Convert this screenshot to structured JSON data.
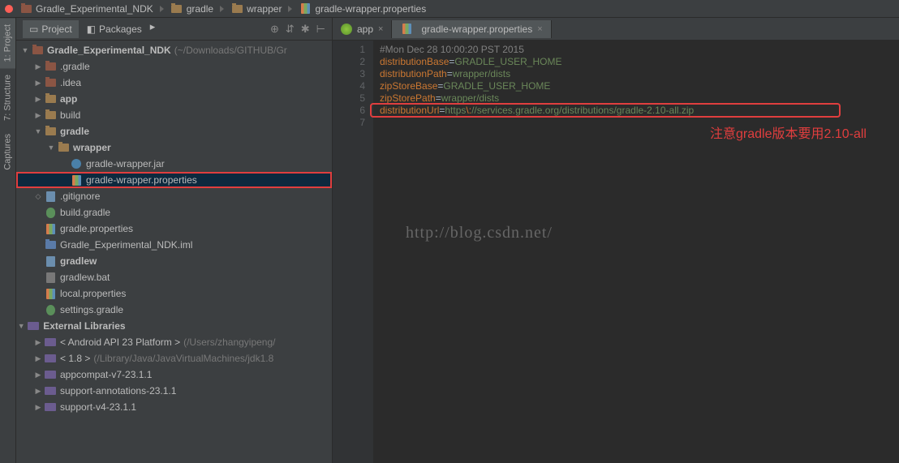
{
  "breadcrumb": [
    {
      "label": "Gradle_Experimental_NDK",
      "icon": "folder-red"
    },
    {
      "label": "gradle",
      "icon": "folder"
    },
    {
      "label": "wrapper",
      "icon": "folder"
    },
    {
      "label": "gradle-wrapper.properties",
      "icon": "props"
    }
  ],
  "leftbar": {
    "items": [
      "1: Project",
      "7: Structure",
      "Captures"
    ]
  },
  "panel": {
    "tabs": [
      "Project",
      "Packages"
    ],
    "active_tab": 0
  },
  "tree": {
    "root": {
      "label": "Gradle_Experimental_NDK",
      "sub": "(~/Downloads/GITHUB/Gr",
      "icon": "folder-red",
      "expanded": true
    },
    "items": [
      {
        "indent": 1,
        "label": ".gradle",
        "icon": "folder-red",
        "arrow": "right"
      },
      {
        "indent": 1,
        "label": ".idea",
        "icon": "folder-red",
        "arrow": "right"
      },
      {
        "indent": 1,
        "label": "app",
        "icon": "folder",
        "arrow": "right",
        "bold": true
      },
      {
        "indent": 1,
        "label": "build",
        "icon": "folder",
        "arrow": "right"
      },
      {
        "indent": 1,
        "label": "gradle",
        "icon": "folder",
        "arrow": "down",
        "bold": true
      },
      {
        "indent": 2,
        "label": "wrapper",
        "icon": "folder",
        "arrow": "down",
        "bold": true
      },
      {
        "indent": 3,
        "label": "gradle-wrapper.jar",
        "icon": "music"
      },
      {
        "indent": 3,
        "label": "gradle-wrapper.properties",
        "icon": "props",
        "selected": true
      },
      {
        "indent": 1,
        "label": ".gitignore",
        "icon": "file-txt",
        "arrow": "diamond"
      },
      {
        "indent": 1,
        "label": "build.gradle",
        "icon": "gradle"
      },
      {
        "indent": 1,
        "label": "gradle.properties",
        "icon": "props"
      },
      {
        "indent": 1,
        "label": "Gradle_Experimental_NDK.iml",
        "icon": "folder-blue"
      },
      {
        "indent": 1,
        "label": "gradlew",
        "icon": "file-txt",
        "bold": true
      },
      {
        "indent": 1,
        "label": "gradlew.bat",
        "icon": "file"
      },
      {
        "indent": 1,
        "label": "local.properties",
        "icon": "props"
      },
      {
        "indent": 1,
        "label": "settings.gradle",
        "icon": "gear"
      }
    ],
    "libs": {
      "label": "External Libraries",
      "expanded": true,
      "items": [
        {
          "label": "< Android API 23 Platform >",
          "sub": "(/Users/zhangyipeng/"
        },
        {
          "label": "< 1.8 >",
          "sub": "(/Library/Java/JavaVirtualMachines/jdk1.8"
        },
        {
          "label": "appcompat-v7-23.1.1",
          "sub": ""
        },
        {
          "label": "support-annotations-23.1.1",
          "sub": ""
        },
        {
          "label": "support-v4-23.1.1",
          "sub": ""
        }
      ]
    }
  },
  "editor_tabs": [
    {
      "label": "app",
      "icon": "app-green",
      "active": false
    },
    {
      "label": "gradle-wrapper.properties",
      "icon": "props",
      "active": true
    }
  ],
  "code": {
    "lines": [
      {
        "n": 1,
        "type": "comment",
        "text": "#Mon Dec 28 10:00:20 PST 2015"
      },
      {
        "n": 2,
        "type": "kv",
        "key": "distributionBase",
        "val": "GRADLE_USER_HOME"
      },
      {
        "n": 3,
        "type": "kv",
        "key": "distributionPath",
        "val": "wrapper/dists"
      },
      {
        "n": 4,
        "type": "kv",
        "key": "zipStoreBase",
        "val": "GRADLE_USER_HOME"
      },
      {
        "n": 5,
        "type": "kv",
        "key": "zipStorePath",
        "val": "wrapper/dists"
      },
      {
        "n": 6,
        "type": "kv",
        "key": "distributionUrl",
        "val_pre": "https",
        "val_esc": "\\:",
        "val_post": "//services.gradle.org/distributions/gradle-2.10-all.zip"
      },
      {
        "n": 7,
        "type": "empty"
      }
    ]
  },
  "annotation": "注意gradle版本要用2.10-all",
  "watermark": "http://blog.csdn.net/"
}
